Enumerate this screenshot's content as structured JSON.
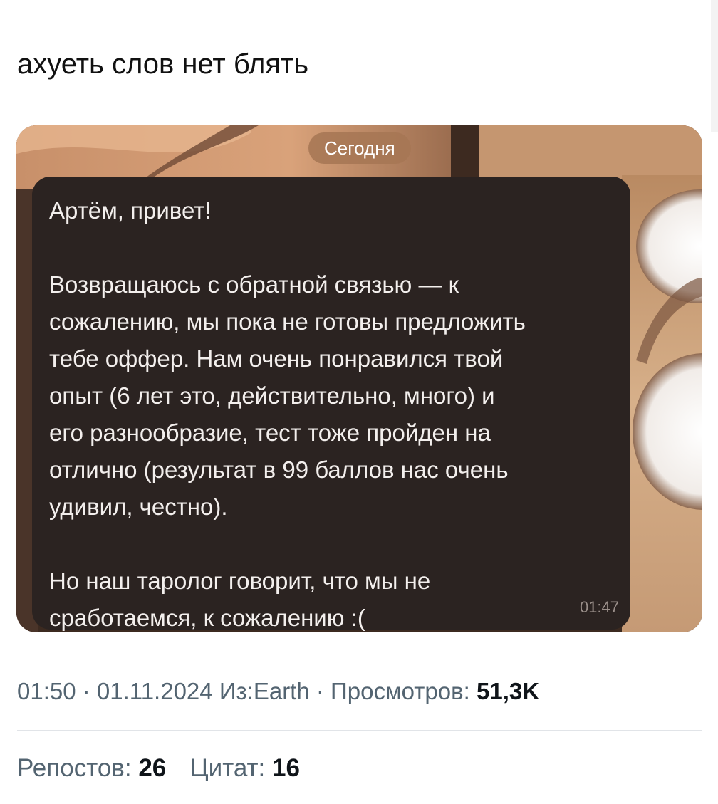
{
  "post": {
    "text": "ахуеть слов нет блять"
  },
  "chat_screenshot": {
    "date_label": "Сегодня",
    "message_lines": [
      "Артём, привет!",
      "",
      "Возвращаюсь с обратной связью — к",
      "сожалению, мы пока не готовы предложить",
      "тебе оффер. Нам очень понравился твой",
      "опыт (6 лет это, действительно, много) и",
      "его разнообразие, тест тоже пройден на",
      "отлично (результат в 99 баллов нас очень",
      "удивил, честно).",
      "",
      "Но наш таролог говорит, что мы не",
      "сработаемся, к сожалению :("
    ],
    "time": "01:47"
  },
  "meta": {
    "time": "01:50",
    "separator": " · ",
    "date": "01.11.2024",
    "source": "Из:Earth",
    "views_label": "Просмотров: ",
    "views_value": "51,3K"
  },
  "stats": {
    "reposts_label": "Репостов: ",
    "reposts_value": "26",
    "quotes_label": "Цитат: ",
    "quotes_value": "16"
  },
  "colors": {
    "bubble_bg": "#2b2321",
    "bubble_text": "#f3efed",
    "muted": "#536471",
    "primary_text": "#0f1419",
    "date_pill": "#a67654"
  }
}
